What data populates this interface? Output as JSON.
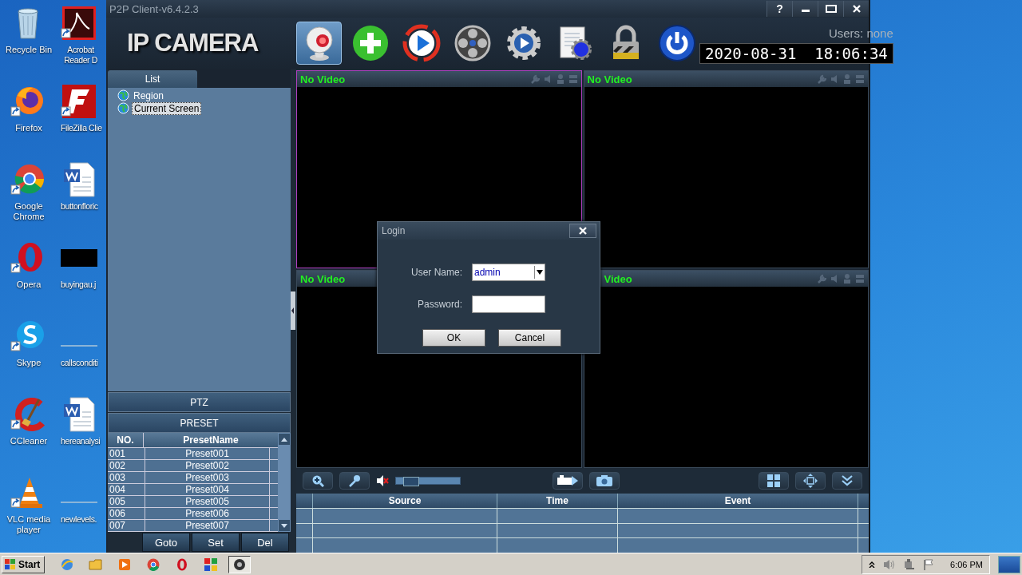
{
  "desktop_icons": [
    {
      "label": "Recycle Bin"
    },
    {
      "label": "Firefox"
    },
    {
      "label": "Google Chrome"
    },
    {
      "label": "Opera"
    },
    {
      "label": "Skype"
    },
    {
      "label": "CCleaner"
    },
    {
      "label": "VLC media player"
    },
    {
      "label": "Acrobat Reader D"
    },
    {
      "label": "FileZilla Clie"
    },
    {
      "label": "buttonfloric"
    },
    {
      "label": "buyingau.j"
    },
    {
      "label": "callsconditi"
    },
    {
      "label": "hereanalysi"
    },
    {
      "label": "newlevels."
    }
  ],
  "window": {
    "title": "P2P Client-v6.4.2.3",
    "help": "?",
    "logo": "IP CAMERA",
    "users": "Users: none",
    "datetime": "2020-08-31  18:06:34"
  },
  "toolbar": [
    {
      "selected": true
    },
    {
      "selected": false
    },
    {
      "selected": false
    },
    {
      "selected": false
    },
    {
      "selected": false
    },
    {
      "selected": false
    },
    {
      "selected": false
    },
    {
      "selected": false
    }
  ],
  "device_panel": {
    "tab": "List",
    "tree": [
      {
        "label": "Region",
        "selected": false
      },
      {
        "label": "Current Screen",
        "selected": true
      }
    ],
    "ptz": "PTZ",
    "preset": "PRESET"
  },
  "preset_table": {
    "columns": [
      "NO.",
      "PresetName"
    ],
    "rows": [
      [
        "001",
        "Preset001"
      ],
      [
        "002",
        "Preset002"
      ],
      [
        "003",
        "Preset003"
      ],
      [
        "004",
        "Preset004"
      ],
      [
        "005",
        "Preset005"
      ],
      [
        "006",
        "Preset006"
      ],
      [
        "007",
        "Preset007"
      ]
    ]
  },
  "preset_buttons": [
    "Goto",
    "Set",
    "Del"
  ],
  "video_cells": [
    {
      "label": "No Video",
      "selected": true
    },
    {
      "label": "No Video",
      "selected": false
    },
    {
      "label": "No Video",
      "selected": false
    },
    {
      "label": "Video",
      "selected": false
    }
  ],
  "volume": {
    "muted": true,
    "level": 0.15
  },
  "event_table": {
    "columns": [
      "Source",
      "Time",
      "Event"
    ]
  },
  "dialog": {
    "title": "Login",
    "fields": [
      {
        "label": "User Name:",
        "kind": "select",
        "value": "admin"
      },
      {
        "label": "Password:",
        "kind": "password"
      }
    ],
    "buttons": [
      "OK",
      "Cancel"
    ]
  },
  "taskbar": {
    "start": "Start",
    "clock": "6:06 PM",
    "apps": [
      {
        "selected": false
      },
      {
        "selected": false
      },
      {
        "selected": false
      },
      {
        "selected": false
      },
      {
        "selected": false
      },
      {
        "selected": false
      },
      {
        "selected": true
      }
    ]
  }
}
